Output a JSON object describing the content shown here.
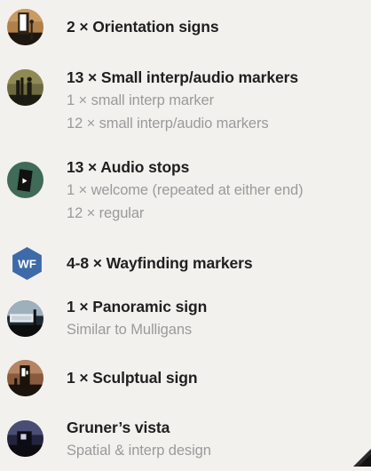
{
  "items": [
    {
      "icon": "orientation-sign-icon",
      "title": "2 × Orientation signs",
      "subs": []
    },
    {
      "icon": "audio-marker-icon",
      "title": "13 × Small interp/audio markers",
      "subs": [
        "1 × small interp marker",
        "12 × small interp/audio markers"
      ]
    },
    {
      "icon": "audio-stop-icon",
      "title": "13 × Audio stops",
      "subs": [
        "1 × welcome (repeated at either end)",
        "12 × regular"
      ]
    },
    {
      "icon": "wayfinding-hexagon-icon",
      "icon_text": "WF",
      "title": "4-8 × Wayfinding markers",
      "subs": []
    },
    {
      "icon": "panoramic-sign-icon",
      "title": "1 × Panoramic sign",
      "subs": [
        "Similar to Mulligans"
      ]
    },
    {
      "icon": "sculptural-sign-icon",
      "title": "1 × Sculptual sign",
      "subs": []
    },
    {
      "icon": "vista-icon",
      "title": "Gruner’s vista",
      "subs": [
        "Spatial & interp design"
      ]
    }
  ]
}
